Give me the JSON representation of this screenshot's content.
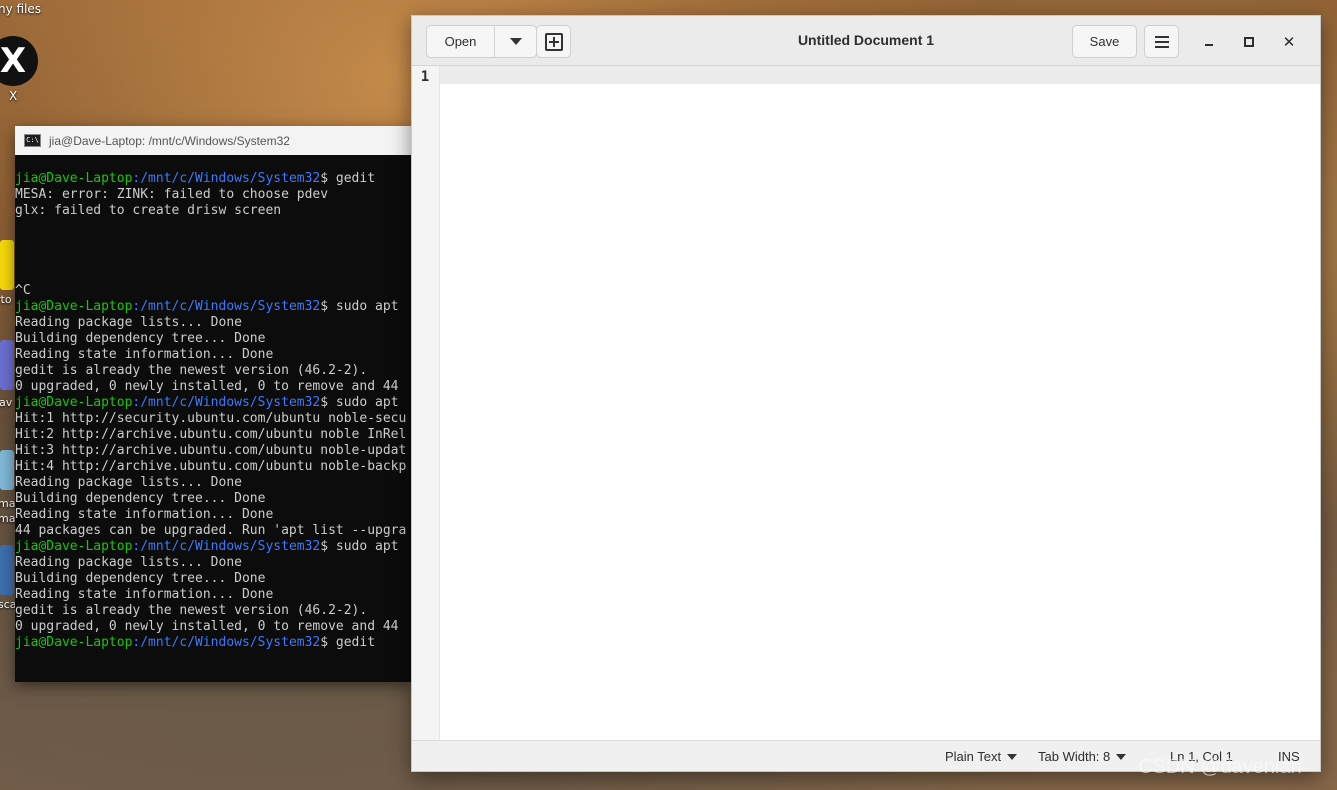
{
  "desktop": {
    "myfiles_label": "ny files",
    "x_icon_glyph": "X",
    "x_label": "X",
    "side_fragments": [
      "rto",
      "lav",
      "ma",
      "ma",
      "sca"
    ]
  },
  "terminal": {
    "title": "jia@Dave-Laptop: /mnt/c/Windows/System32",
    "icon_text": "C:\\",
    "prompt_user": "jia@Dave-Laptop",
    "prompt_path": ":/mnt/c/Windows/System32",
    "lines": [
      {
        "type": "prompt",
        "cmd": "$ gedit"
      },
      {
        "type": "text",
        "text": "MESA: error: ZINK: failed to choose pdev"
      },
      {
        "type": "text",
        "text": "glx: failed to create drisw screen"
      },
      {
        "type": "text",
        "text": ""
      },
      {
        "type": "text",
        "text": ""
      },
      {
        "type": "text",
        "text": ""
      },
      {
        "type": "text",
        "text": ""
      },
      {
        "type": "text",
        "text": "^C"
      },
      {
        "type": "prompt",
        "cmd": "$ sudo apt"
      },
      {
        "type": "text",
        "text": "Reading package lists... Done"
      },
      {
        "type": "text",
        "text": "Building dependency tree... Done"
      },
      {
        "type": "text",
        "text": "Reading state information... Done"
      },
      {
        "type": "text",
        "text": "gedit is already the newest version (46.2-2)."
      },
      {
        "type": "text",
        "text": "0 upgraded, 0 newly installed, 0 to remove and 44"
      },
      {
        "type": "prompt",
        "cmd": "$ sudo apt"
      },
      {
        "type": "text",
        "text": "Hit:1 http://security.ubuntu.com/ubuntu noble-secu"
      },
      {
        "type": "text",
        "text": "Hit:2 http://archive.ubuntu.com/ubuntu noble InRel"
      },
      {
        "type": "text",
        "text": "Hit:3 http://archive.ubuntu.com/ubuntu noble-updat"
      },
      {
        "type": "text",
        "text": "Hit:4 http://archive.ubuntu.com/ubuntu noble-backp"
      },
      {
        "type": "text",
        "text": "Reading package lists... Done"
      },
      {
        "type": "text",
        "text": "Building dependency tree... Done"
      },
      {
        "type": "text",
        "text": "Reading state information... Done"
      },
      {
        "type": "text",
        "text": "44 packages can be upgraded. Run 'apt list --upgra"
      },
      {
        "type": "prompt",
        "cmd": "$ sudo apt"
      },
      {
        "type": "text",
        "text": "Reading package lists... Done"
      },
      {
        "type": "text",
        "text": "Building dependency tree... Done"
      },
      {
        "type": "text",
        "text": "Reading state information... Done"
      },
      {
        "type": "text",
        "text": "gedit is already the newest version (46.2-2)."
      },
      {
        "type": "text",
        "text": "0 upgraded, 0 newly installed, 0 to remove and 44"
      },
      {
        "type": "prompt",
        "cmd": "$ gedit"
      }
    ]
  },
  "gedit": {
    "open_label": "Open",
    "title": "Untitled Document 1",
    "save_label": "Save",
    "line_number": "1",
    "status": {
      "language": "Plain Text",
      "tab_width": "Tab Width: 8",
      "position": "Ln 1, Col 1",
      "mode": "INS"
    }
  },
  "watermark": "CSDN @davenian",
  "colors": {
    "terminal_bg": "#0c0c0c",
    "prompt_user": "#16c60c",
    "prompt_path": "#3b78ff",
    "terminal_text": "#cccccc"
  }
}
